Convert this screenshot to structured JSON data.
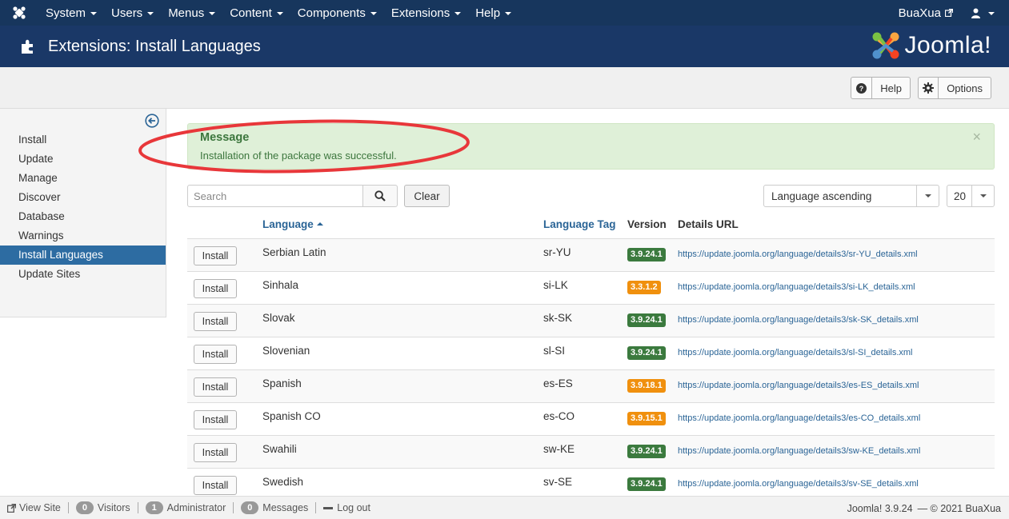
{
  "nav": {
    "menu": [
      "System",
      "Users",
      "Menus",
      "Content",
      "Components",
      "Extensions",
      "Help"
    ],
    "site_name": "BuaXua"
  },
  "header": {
    "title": "Extensions: Install Languages",
    "brand": "Joomla!"
  },
  "toolbar": {
    "help_label": "Help",
    "options_label": "Options"
  },
  "sidebar": {
    "items": [
      {
        "label": "Install",
        "active": false
      },
      {
        "label": "Update",
        "active": false
      },
      {
        "label": "Manage",
        "active": false
      },
      {
        "label": "Discover",
        "active": false
      },
      {
        "label": "Database",
        "active": false
      },
      {
        "label": "Warnings",
        "active": false
      },
      {
        "label": "Install Languages",
        "active": true
      },
      {
        "label": "Update Sites",
        "active": false
      }
    ]
  },
  "message": {
    "title": "Message",
    "text": "Installation of the package was successful.",
    "close": "×"
  },
  "filters": {
    "search_placeholder": "Search",
    "clear_label": "Clear",
    "ordering": "Language ascending",
    "limit": "20"
  },
  "table": {
    "headers": {
      "language": "Language",
      "tag": "Language Tag",
      "version": "Version",
      "details_url": "Details URL"
    },
    "install_label": "Install",
    "rows": [
      {
        "language": "Serbian Latin",
        "tag": "sr-YU",
        "version": "3.9.24.1",
        "status": "green",
        "url": "https://update.joomla.org/language/details3/sr-YU_details.xml"
      },
      {
        "language": "Sinhala",
        "tag": "si-LK",
        "version": "3.3.1.2",
        "status": "orange",
        "url": "https://update.joomla.org/language/details3/si-LK_details.xml"
      },
      {
        "language": "Slovak",
        "tag": "sk-SK",
        "version": "3.9.24.1",
        "status": "green",
        "url": "https://update.joomla.org/language/details3/sk-SK_details.xml"
      },
      {
        "language": "Slovenian",
        "tag": "sl-SI",
        "version": "3.9.24.1",
        "status": "green",
        "url": "https://update.joomla.org/language/details3/sl-SI_details.xml"
      },
      {
        "language": "Spanish",
        "tag": "es-ES",
        "version": "3.9.18.1",
        "status": "orange",
        "url": "https://update.joomla.org/language/details3/es-ES_details.xml"
      },
      {
        "language": "Spanish CO",
        "tag": "es-CO",
        "version": "3.9.15.1",
        "status": "orange",
        "url": "https://update.joomla.org/language/details3/es-CO_details.xml"
      },
      {
        "language": "Swahili",
        "tag": "sw-KE",
        "version": "3.9.24.1",
        "status": "green",
        "url": "https://update.joomla.org/language/details3/sw-KE_details.xml"
      },
      {
        "language": "Swedish",
        "tag": "sv-SE",
        "version": "3.9.24.1",
        "status": "green",
        "url": "https://update.joomla.org/language/details3/sv-SE_details.xml"
      }
    ]
  },
  "statusbar": {
    "view_site": "View Site",
    "visitors_count": "0",
    "visitors_label": "Visitors",
    "admin_count": "1",
    "admin_label": "Administrator",
    "messages_count": "0",
    "messages_label": "Messages",
    "logout": "Log out",
    "version": "Joomla! 3.9.24",
    "copyright": "— © 2021 BuaXua"
  },
  "colors": {
    "navbar": "#17365d",
    "header": "#1a3867",
    "active_sidebar": "#2d6ca2",
    "success_bg": "#dff0d8",
    "badge_green": "#3b7a3e",
    "badge_orange": "#f0900e",
    "link": "#2a6496",
    "annotation": "#e8373a"
  }
}
